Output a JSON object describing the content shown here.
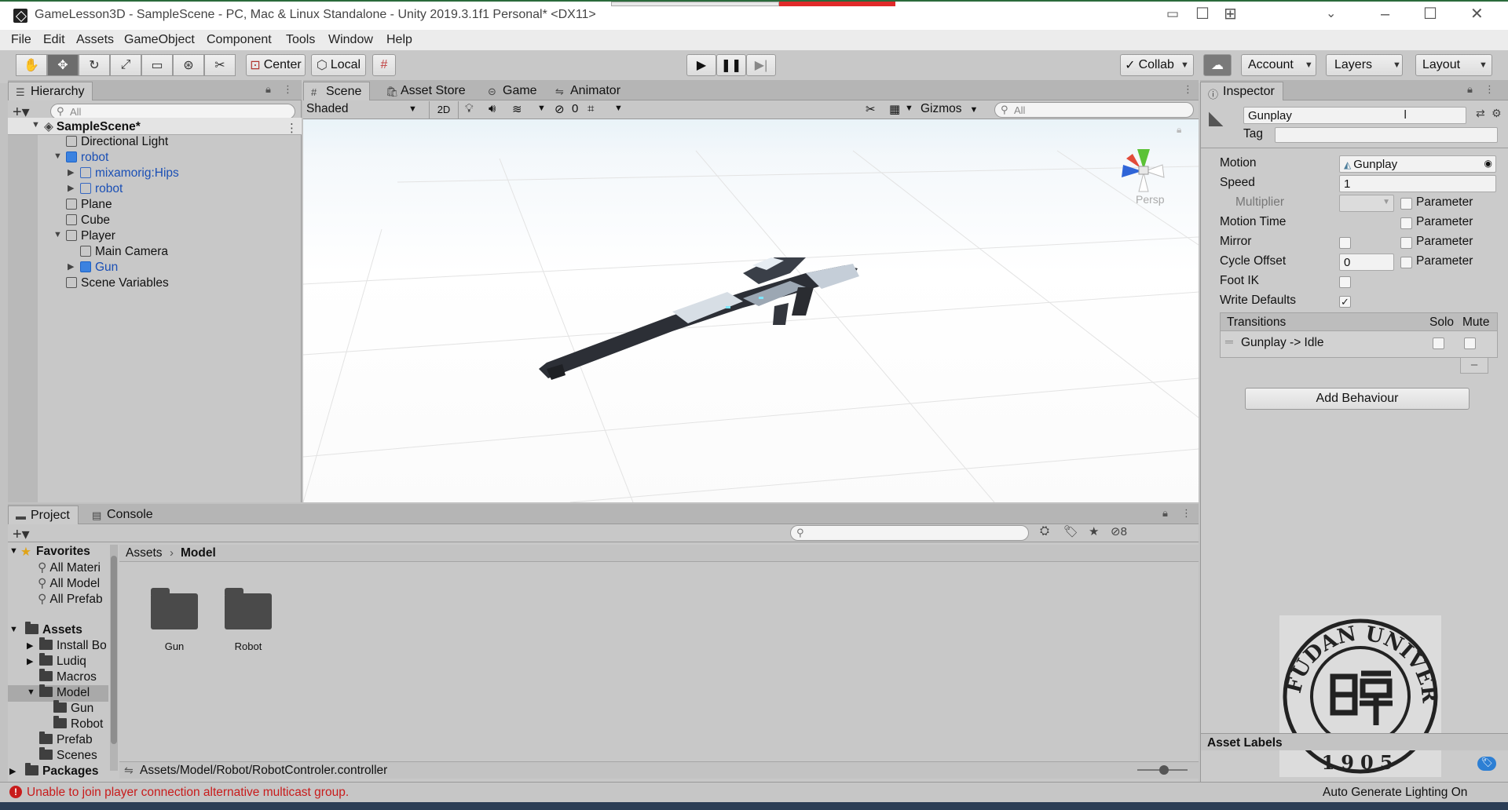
{
  "window": {
    "title": "GameLesson3D - SampleScene - PC, Mac & Linux Standalone - Unity 2019.3.1f1 Personal* <DX11>"
  },
  "menu": [
    "File",
    "Edit",
    "Assets",
    "GameObject",
    "Component",
    "Tools",
    "Window",
    "Help"
  ],
  "toolbar": {
    "pivot": "Center",
    "space": "Local",
    "collab": "Collab",
    "account": "Account",
    "layers": "Layers",
    "layout": "Layout"
  },
  "hierarchy": {
    "tab": "Hierarchy",
    "search_placeholder": "All",
    "items": [
      {
        "label": "SampleScene*"
      },
      {
        "label": "Directional Light"
      },
      {
        "label": "robot"
      },
      {
        "label": "mixamorig:Hips"
      },
      {
        "label": "robot"
      },
      {
        "label": "Plane"
      },
      {
        "label": "Cube"
      },
      {
        "label": "Player"
      },
      {
        "label": "Main Camera"
      },
      {
        "label": "Gun"
      },
      {
        "label": "Scene Variables"
      }
    ]
  },
  "scene": {
    "tabs": [
      "Scene",
      "Asset Store",
      "Game",
      "Animator"
    ],
    "shading": "Shaded",
    "mode_2d": "2D",
    "hidden_count": "0",
    "gizmos": "Gizmos",
    "search_placeholder": "All",
    "camera_label": "Persp"
  },
  "inspector": {
    "tab": "Inspector",
    "name": "Gunplay",
    "tag_label": "Tag",
    "fields": {
      "motion_label": "Motion",
      "motion_value": "Gunplay",
      "speed_label": "Speed",
      "speed_value": "1",
      "multiplier_label": "Multiplier",
      "motion_time_label": "Motion Time",
      "mirror_label": "Mirror",
      "cycle_offset_label": "Cycle Offset",
      "cycle_offset_value": "0",
      "foot_ik_label": "Foot IK",
      "write_defaults_label": "Write Defaults",
      "parameter": "Parameter"
    },
    "transitions": {
      "header": "Transitions",
      "solo": "Solo",
      "mute": "Mute",
      "items": [
        "Gunplay -> Idle"
      ]
    },
    "add_behaviour": "Add Behaviour",
    "asset_labels": "Asset Labels",
    "write_defaults_checked": true
  },
  "project": {
    "tabs": [
      "Project",
      "Console"
    ],
    "hidden_count": "8",
    "tree": [
      {
        "label": "Favorites"
      },
      {
        "label": "All Materi"
      },
      {
        "label": "All Model"
      },
      {
        "label": "All Prefab"
      },
      {
        "label": "Assets"
      },
      {
        "label": "Install Bo"
      },
      {
        "label": "Ludiq"
      },
      {
        "label": "Macros"
      },
      {
        "label": "Model"
      },
      {
        "label": "Gun"
      },
      {
        "label": "Robot"
      },
      {
        "label": "Prefab"
      },
      {
        "label": "Scenes"
      },
      {
        "label": "Packages"
      }
    ],
    "breadcrumb": [
      "Assets",
      "Model"
    ],
    "folders": [
      "Gun",
      "Robot"
    ],
    "selected_path": "Assets/Model/Robot/RobotControler.controller"
  },
  "status": {
    "error": "Unable to join player connection alternative multicast group.",
    "right": "Auto Generate Lighting On"
  },
  "watermark": {
    "text_top": "FUDAN UNIVERSITY",
    "year": "1905"
  },
  "colors": {
    "panel": "#c8c8c8",
    "accent_blue": "#1a4fb5",
    "error_red": "#c81b1b",
    "play_red": "#e02a2a"
  }
}
